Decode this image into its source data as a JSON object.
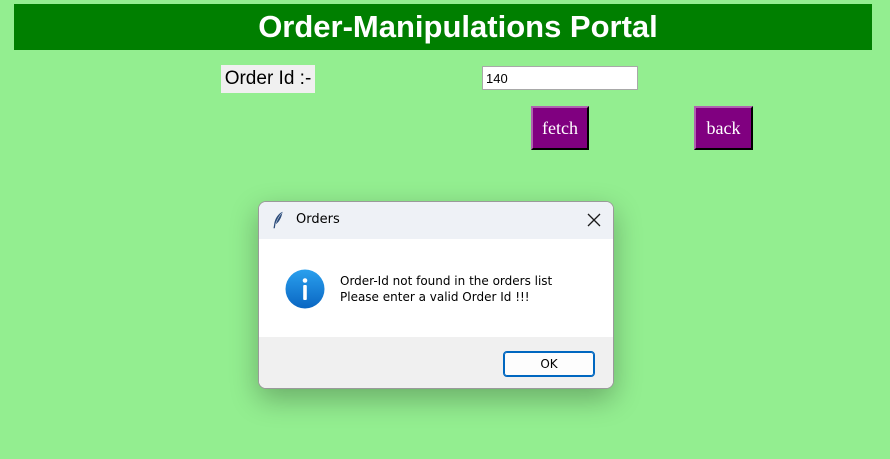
{
  "app": {
    "title": "Order-Manipulations Portal"
  },
  "form": {
    "order_id_label": "Order Id :-",
    "order_id_value": "140",
    "fetch_label": "fetch",
    "back_label": "back"
  },
  "colors": {
    "background": "#93ee90",
    "title_bar": "#007f00",
    "button": "#800080",
    "ok_border": "#0067c0"
  },
  "dialog": {
    "title": "Orders",
    "title_icon": "feather-icon",
    "message_icon": "info-icon",
    "message_lines": [
      "Order-Id not found in the orders list",
      "Please enter a valid Order Id !!!"
    ],
    "ok_label": "OK"
  }
}
